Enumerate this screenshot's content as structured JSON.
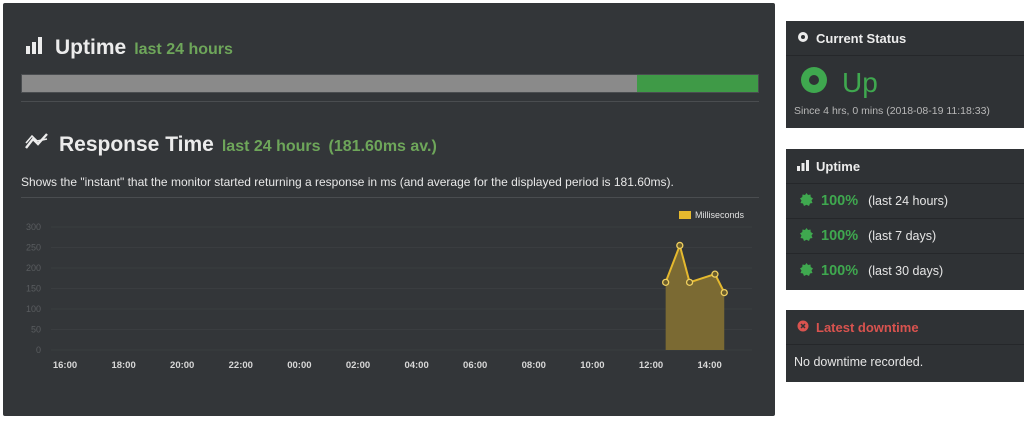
{
  "uptime_section": {
    "title": "Uptime",
    "period": "last 24 hours",
    "up_fraction": 0.165
  },
  "response_section": {
    "title": "Response Time",
    "period": "last 24 hours",
    "average": "(181.60ms av.)",
    "description": "Shows the \"instant\" that the monitor started returning a response in ms (and average for the displayed period is 181.60ms)."
  },
  "chart_data": {
    "type": "area",
    "series": [
      {
        "name": "Milliseconds",
        "x": [
          "12:30",
          "12:59",
          "13:19",
          "14:11",
          "14:30"
        ],
        "values": [
          165,
          255,
          165,
          185,
          140
        ]
      }
    ],
    "x_ticks": [
      "16:00",
      "18:00",
      "20:00",
      "22:00",
      "00:00",
      "02:00",
      "04:00",
      "06:00",
      "08:00",
      "10:00",
      "12:00",
      "14:00"
    ],
    "y_ticks": [
      "0",
      "50",
      "100",
      "150",
      "200",
      "250",
      "300"
    ],
    "ylim": [
      0,
      300
    ],
    "legend_position": "top-right",
    "grid": true,
    "colors": {
      "line": "#e5b92e",
      "fill": "#7b6a33"
    }
  },
  "sidebar": {
    "current_status": {
      "title": "Current Status",
      "status": "Up",
      "since": "Since 4 hrs, 0 mins (2018-08-19 11:18:33)"
    },
    "uptime": {
      "title": "Uptime",
      "rows": [
        {
          "pct": "100%",
          "period": "(last 24 hours)"
        },
        {
          "pct": "100%",
          "period": "(last 7 days)"
        },
        {
          "pct": "100%",
          "period": "(last 30 days)"
        }
      ]
    },
    "latest_downtime": {
      "title": "Latest downtime",
      "message": "No downtime recorded."
    }
  },
  "colors": {
    "panel": "#333639",
    "accent_green": "#3fa84f",
    "subtitle_green": "#6ea65a",
    "downtime_red": "#d9534f"
  },
  "icons": [
    "bar-chart-icon",
    "line-chart-icon",
    "circle-dot-icon",
    "badge-check-icon",
    "times-circle-icon"
  ]
}
